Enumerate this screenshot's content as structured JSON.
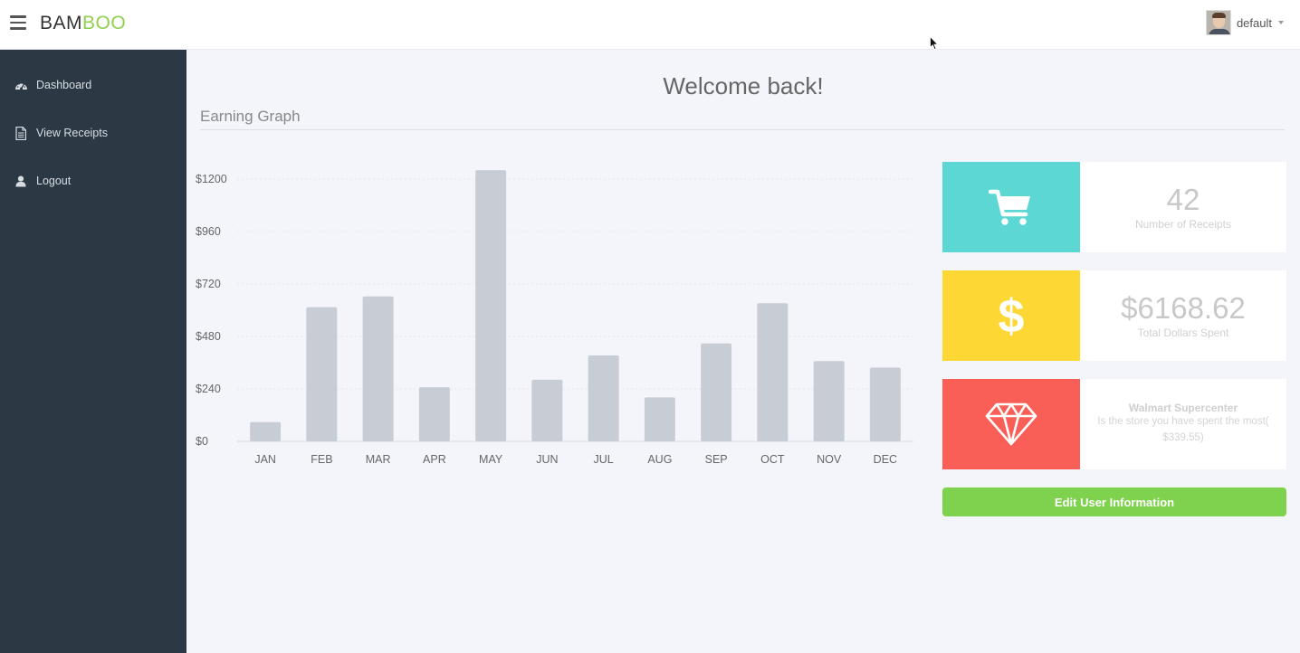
{
  "header": {
    "brand_part1": "BAM",
    "brand_part2": "BOO",
    "user_name": "default"
  },
  "sidebar": {
    "items": [
      {
        "label": "Dashboard",
        "icon": "dashboard-icon"
      },
      {
        "label": "View Receipts",
        "icon": "document-icon"
      },
      {
        "label": "Logout",
        "icon": "user-icon"
      }
    ]
  },
  "main": {
    "welcome": "Welcome back!",
    "section_title": "Earning Graph"
  },
  "stats": {
    "receipts_count": "42",
    "receipts_label": "Number of Receipts",
    "total_spent": "$6168.62",
    "total_spent_label": "Total Dollars Spent",
    "store_name": "Walmart Supercenter",
    "store_desc_line1": "Is the store you have spent the most(",
    "store_desc_line2": "$339.55)"
  },
  "actions": {
    "edit_label": "Edit User Information"
  },
  "colors": {
    "accent_green": "#7fd24d",
    "tile_teal": "#5dd7d4",
    "tile_yellow": "#fdd835",
    "tile_red": "#fa5f57",
    "bar": "#c8ccd5",
    "sidebar": "#2c3945"
  },
  "chart_data": {
    "type": "bar",
    "categories": [
      "JAN",
      "FEB",
      "MAR",
      "APR",
      "MAY",
      "JUN",
      "JUL",
      "AUG",
      "SEP",
      "OCT",
      "NOV",
      "DEC"
    ],
    "values": [
      88,
      614,
      663,
      248,
      1241,
      282,
      393,
      201,
      448,
      632,
      367,
      338
    ],
    "yticks": [
      "$0",
      "$240",
      "$480",
      "$720",
      "$960",
      "$1200"
    ],
    "ylim": [
      0,
      1200
    ],
    "grid": true,
    "title": "",
    "xlabel": "",
    "ylabel": ""
  }
}
